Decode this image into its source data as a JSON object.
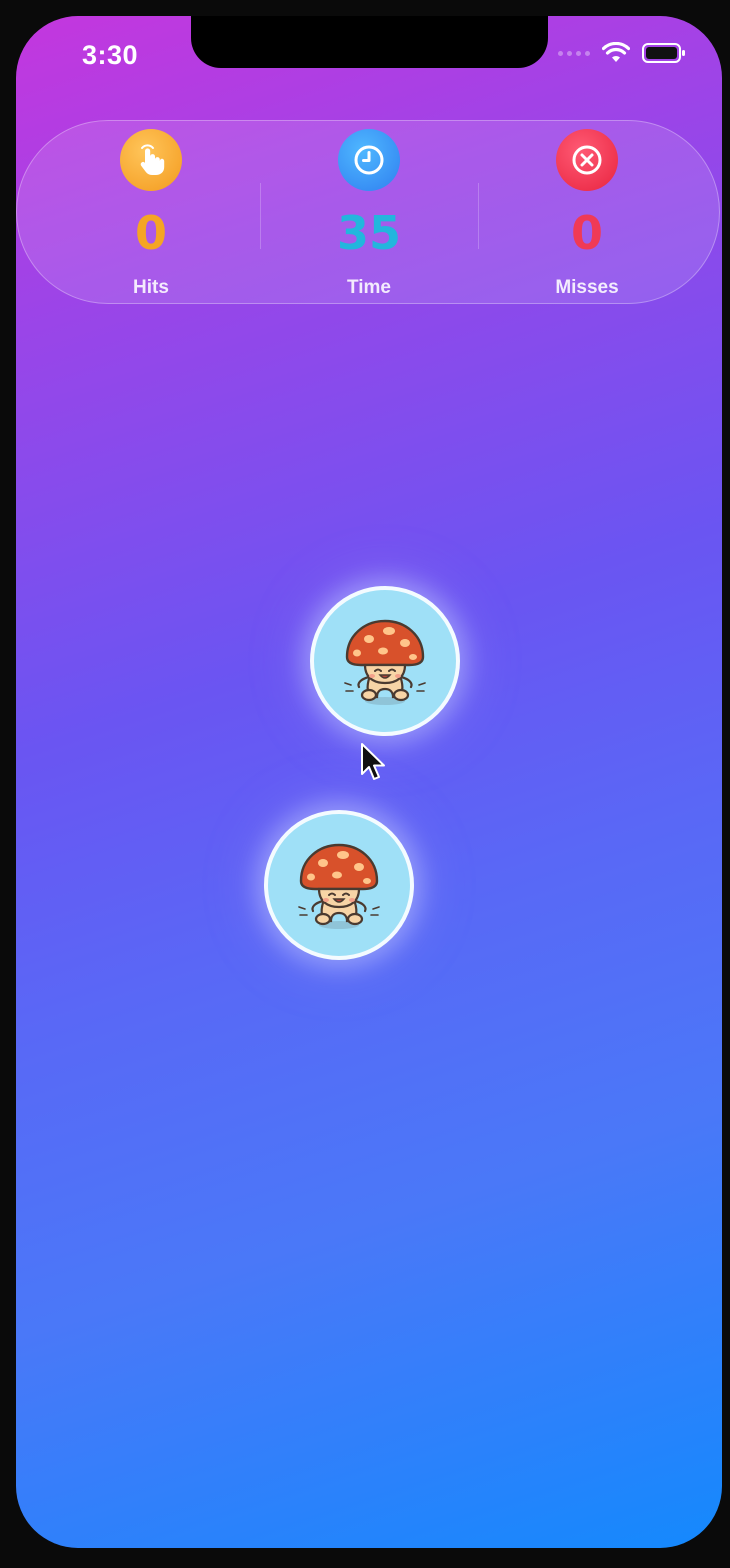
{
  "status_bar": {
    "time": "3:30"
  },
  "hud": {
    "hits": {
      "value": "0",
      "label": "Hits",
      "color": "#f5a524",
      "icon": "tap-hand-icon"
    },
    "time": {
      "value": "35",
      "label": "Time",
      "color": "#22b6dd",
      "icon": "clock-icon"
    },
    "misses": {
      "value": "0",
      "label": "Misses",
      "color": "#f03a56",
      "icon": "close-circle-icon"
    }
  },
  "targets": [
    {
      "character": "mushroom",
      "icon": "mushroom-character-icon"
    },
    {
      "character": "mushroom",
      "icon": "mushroom-character-icon"
    }
  ],
  "colors": {
    "background_top": "#c437de",
    "background_bottom": "#1489fd",
    "target_fill": "#9fe0f7"
  }
}
